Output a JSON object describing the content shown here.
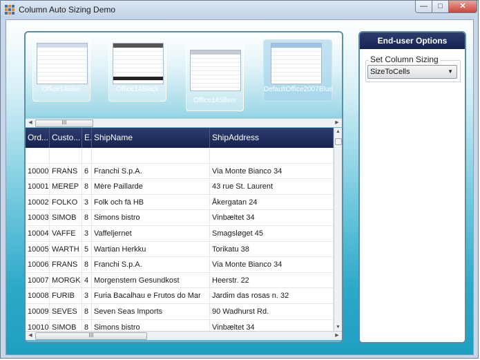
{
  "window": {
    "title": "Column Auto Sizing Demo"
  },
  "themes": [
    {
      "label": "Office14Blue"
    },
    {
      "label": "Office14Black"
    },
    {
      "label": "Office14Silver"
    },
    {
      "label": "DefaultOffice2007Blue"
    }
  ],
  "grid": {
    "columns": [
      "Ord...",
      "Custo...",
      "E.",
      "ShipName",
      "ShipAddress"
    ],
    "rows": [
      [
        "10000",
        "FRANS",
        "6",
        "Franchi S.p.A.",
        "Via Monte Bianco 34"
      ],
      [
        "10001",
        "MEREP",
        "8",
        "Mère Paillarde",
        "43 rue St. Laurent"
      ],
      [
        "10002",
        "FOLKO",
        "3",
        "Folk och fä HB",
        "Åkergatan 24"
      ],
      [
        "10003",
        "SIMOB",
        "8",
        "Simons bistro",
        "Vinbæltet 34"
      ],
      [
        "10004",
        "VAFFE",
        "3",
        "Vaffeljernet",
        "Smagsløget 45"
      ],
      [
        "10005",
        "WARTH",
        "5",
        "Wartian Herkku",
        "Torikatu 38"
      ],
      [
        "10006",
        "FRANS",
        "8",
        "Franchi S.p.A.",
        "Via Monte Bianco 34"
      ],
      [
        "10007",
        "MORGK",
        "4",
        "Morgenstern Gesundkost",
        "Heerstr. 22"
      ],
      [
        "10008",
        "FURIB",
        "3",
        "Furia Bacalhau e Frutos do Mar",
        "Jardim das rosas n. 32"
      ],
      [
        "10009",
        "SEVES",
        "8",
        "Seven Seas Imports",
        "90 Wadhurst Rd."
      ],
      [
        "10010",
        "SIMOB",
        "8",
        "Simons bistro",
        "Vinbæltet 34"
      ]
    ]
  },
  "options": {
    "header": "End-user Options",
    "sizing_label": "Set Column Sizing",
    "sizing_value": "SizeToCells"
  }
}
